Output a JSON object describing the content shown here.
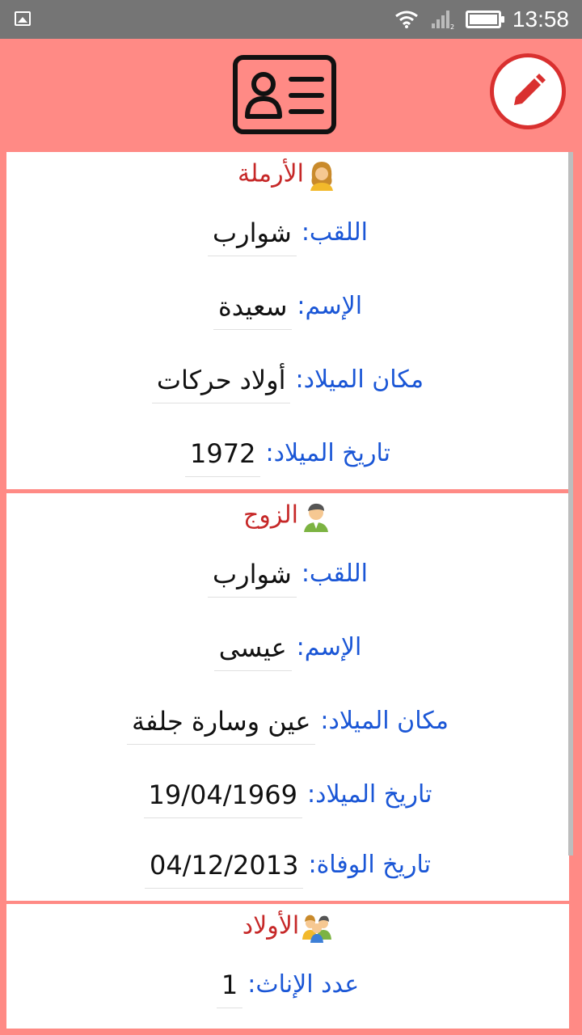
{
  "status_bar": {
    "time": "13:58"
  },
  "widow": {
    "title": "الأرملة",
    "fields": [
      {
        "label": "اللقب:",
        "value": "شوارب"
      },
      {
        "label": "الإسم:",
        "value": "سعيدة"
      },
      {
        "label": "مكان الميلاد:",
        "value": "أولاد حركات"
      },
      {
        "label": "تاريخ الميلاد:",
        "value": "1972"
      }
    ]
  },
  "husband": {
    "title": "الزوج",
    "fields": [
      {
        "label": "اللقب:",
        "value": "شوارب"
      },
      {
        "label": "الإسم:",
        "value": "عيسى"
      },
      {
        "label": "مكان الميلاد:",
        "value": "عين وسارة جلفة"
      },
      {
        "label": "تاريخ الميلاد:",
        "value": "19/04/1969"
      },
      {
        "label": "تاريخ الوفاة:",
        "value": "04/12/2013"
      }
    ]
  },
  "children": {
    "title": "الأولاد",
    "fields": [
      {
        "label": "عدد الإناث:",
        "value": "1"
      }
    ]
  },
  "colors": {
    "background": "#ff8a85",
    "accent": "#d9302f",
    "label": "#1a56d6",
    "title": "#c62828"
  },
  "icons": {
    "header": "id-card-icon",
    "edit": "pencil-icon"
  }
}
